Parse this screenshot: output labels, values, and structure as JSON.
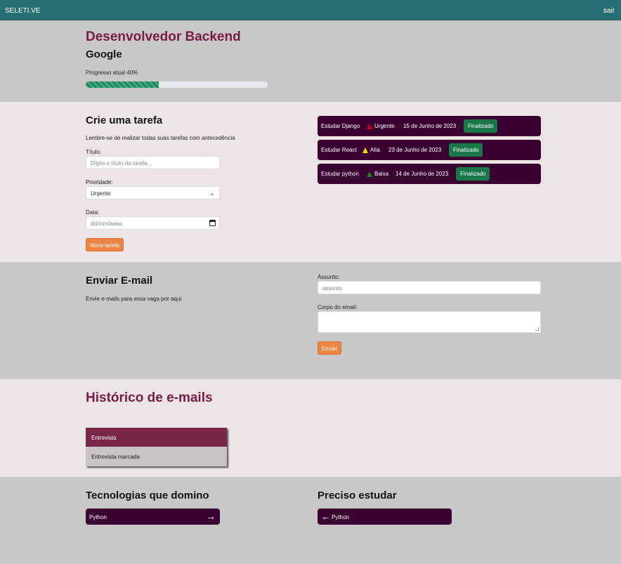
{
  "nav": {
    "brand": "SELETI.VE",
    "logout": "sair"
  },
  "job": {
    "title": "Desenvolvedor Backend",
    "company": "Google",
    "progress_label": "Progresso atual 40%",
    "progress_value": 0.4
  },
  "task_form": {
    "title": "Crie uma tarefa",
    "subtitle": "Lembre-se de realizar todas suas tarefas com antecedência",
    "title_label": "Título:",
    "title_placeholder": "Digite o título da tarefa...",
    "priority_label": "Prioridade:",
    "priority_value": "Urgente",
    "date_label": "Data:",
    "date_placeholder": "dd/mm/aaaa",
    "submit": "Nova tarefa"
  },
  "tasks": [
    {
      "name": "Estudar Django",
      "priority": "Urgente",
      "priority_color": "#d0021b",
      "date": "15 de Junho de 2023",
      "action": "Finalizado"
    },
    {
      "name": "Estudar React",
      "priority": "Alta",
      "priority_color": "#f5d800",
      "date": "23 de Junho de 2023",
      "action": "Finalizado"
    },
    {
      "name": "Estudar python",
      "priority": "Baixa",
      "priority_color": "#1e7a1e",
      "date": "14 de Junho de 2023",
      "action": "Finalizado"
    }
  ],
  "email": {
    "title": "Enviar E-mail",
    "subtitle": "Envie e-mails para essa vaga por aqui.",
    "subject_label": "Assunto:",
    "subject_placeholder": "assunto",
    "body_label": "Corpo do email:",
    "send": "Enviar"
  },
  "history": {
    "title": "Histórico de e-mails",
    "items": [
      {
        "subject": "Entrevista",
        "body": "Entrevista marcada"
      }
    ]
  },
  "skills": {
    "known_title": "Tecnologias que domino",
    "known": [
      "Python"
    ],
    "study_title": "Preciso estudar",
    "study": [
      "Python"
    ],
    "arrow_right_icon": "arrow-right-icon",
    "arrow_left_icon": "arrow-left-icon"
  },
  "colors": {
    "navbar": "#286f75",
    "accent": "#7a1b43",
    "task_bg": "#3a0032",
    "success": "#18784a",
    "orange": "#ef8544"
  }
}
